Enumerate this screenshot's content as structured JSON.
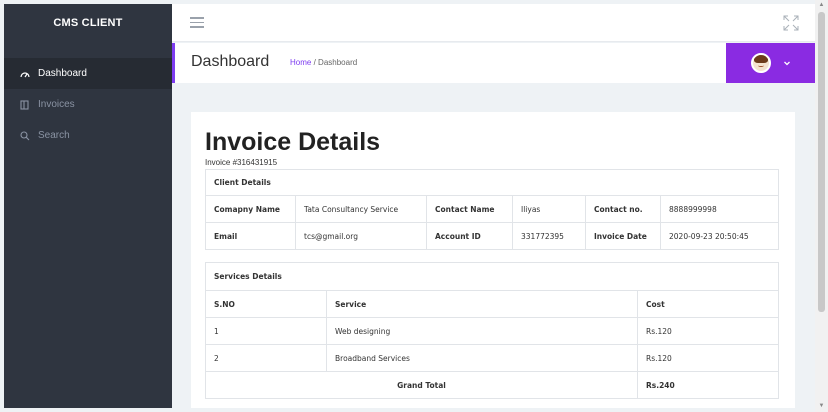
{
  "sidebar": {
    "brand": "CMS CLIENT",
    "items": [
      {
        "label": "Dashboard",
        "icon": "dashboard-gauge-icon"
      },
      {
        "label": "Invoices",
        "icon": "invoice-icon"
      },
      {
        "label": "Search",
        "icon": "search-icon"
      }
    ]
  },
  "topbar": {
    "menu_icon": "hamburger-icon",
    "fullscreen_icon": "expand-icon"
  },
  "header": {
    "title": "Dashboard",
    "breadcrumb": {
      "home": "Home",
      "separator": "/",
      "current": "Dashboard"
    },
    "accent": "#8a2be2"
  },
  "invoice": {
    "title": "Invoice Details",
    "number": "Invoice #316431915",
    "client_section_title": "Client Details",
    "client": {
      "company_label": "Comapny Name",
      "company": "Tata Consultancy Service",
      "contact_name_label": "Contact Name",
      "contact_name": "Iliyas",
      "contact_no_label": "Contact no.",
      "contact_no": "8888999998",
      "email_label": "Email",
      "email": "tcs@gmail.org",
      "account_id_label": "Account ID",
      "account_id": "331772395",
      "invoice_date_label": "Invoice Date",
      "invoice_date": "2020-09-23 20:50:45"
    },
    "services_section_title": "Services Details",
    "services_headers": {
      "sno": "S.NO",
      "service": "Service",
      "cost": "Cost"
    },
    "services": [
      {
        "sno": "1",
        "service": "Web designing",
        "cost": "Rs.120"
      },
      {
        "sno": "2",
        "service": "Broadband Services",
        "cost": "Rs.120"
      }
    ],
    "grand_total_label": "Grand Total",
    "grand_total": "Rs.240"
  }
}
